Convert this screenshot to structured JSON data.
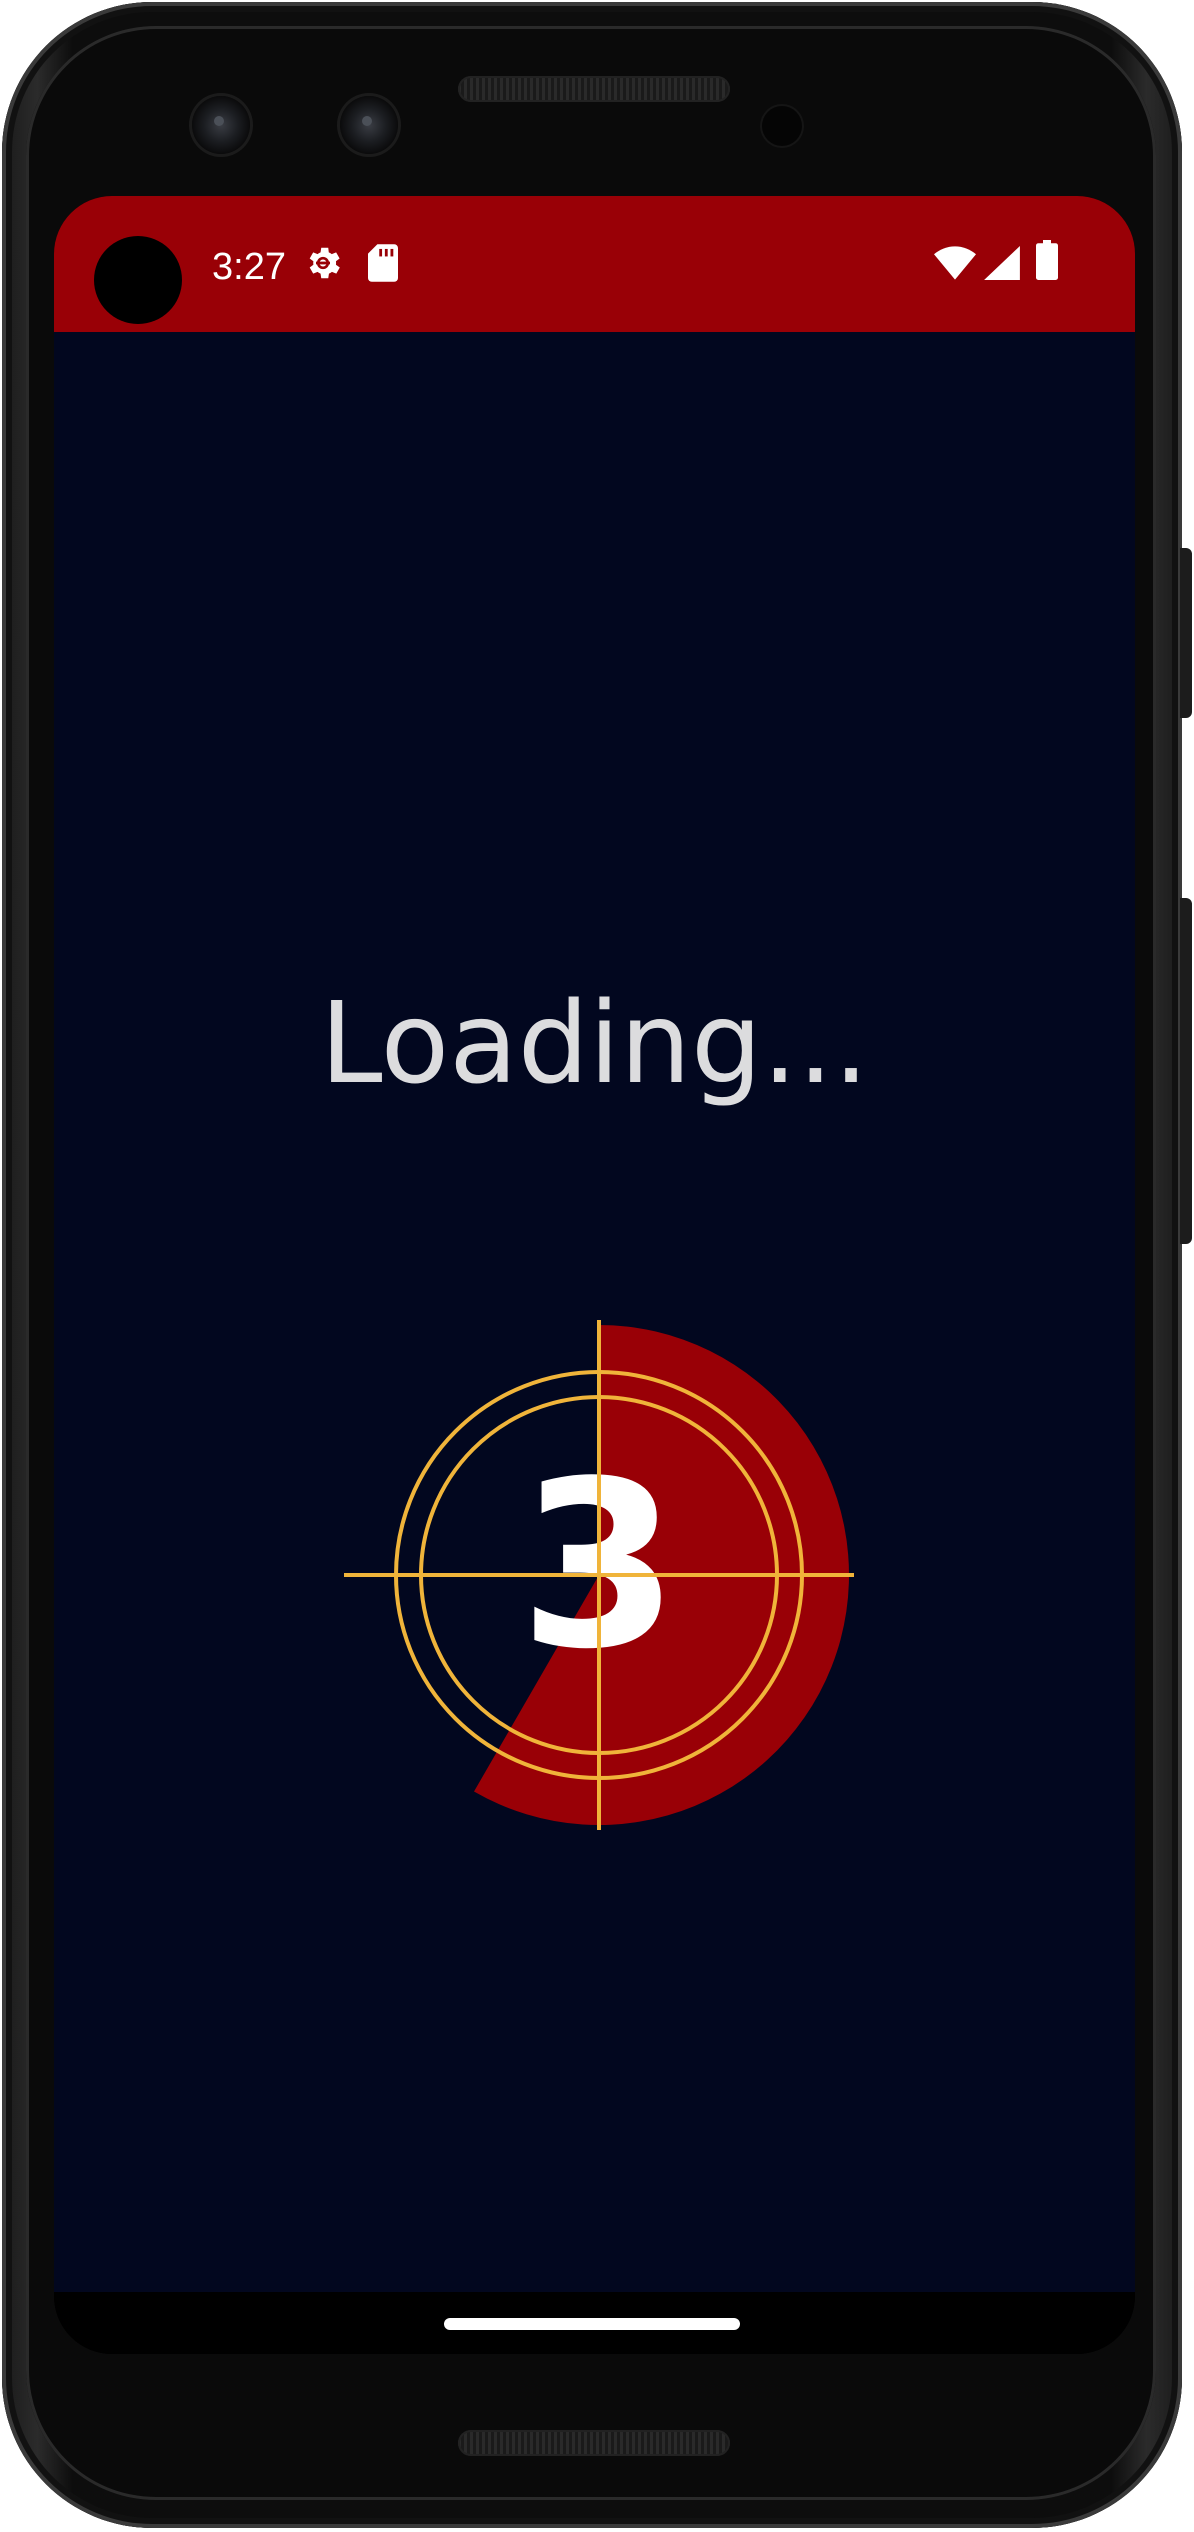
{
  "status_bar": {
    "time": "3:27",
    "left_icons": [
      "gear-icon",
      "sd-card-icon"
    ],
    "right_icons": [
      "wifi-icon",
      "cell-signal-icon",
      "battery-icon"
    ],
    "background_color": "#990006"
  },
  "app": {
    "background_color": "#02071f",
    "loading_label": "Loading...",
    "countdown": {
      "number": "3",
      "accent_color": "#990006",
      "ring_color": "#f0b43a"
    }
  },
  "navigation": {
    "home_indicator": "home-gesture-bar"
  }
}
